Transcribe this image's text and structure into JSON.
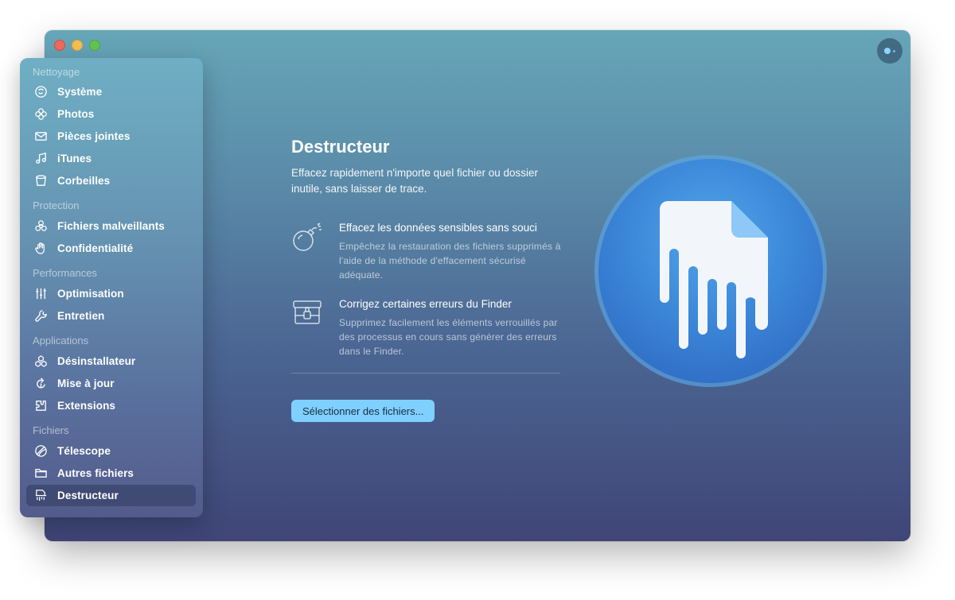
{
  "sidebar": {
    "sections": [
      {
        "title": "Nettoyage",
        "items": [
          {
            "label": "Système",
            "icon": "system-icon"
          },
          {
            "label": "Photos",
            "icon": "photos-icon"
          },
          {
            "label": "Pièces jointes",
            "icon": "mail-icon"
          },
          {
            "label": "iTunes",
            "icon": "music-icon"
          },
          {
            "label": "Corbeilles",
            "icon": "trash-icon"
          }
        ]
      },
      {
        "title": "Protection",
        "items": [
          {
            "label": "Fichiers malveillants",
            "icon": "biohazard-icon"
          },
          {
            "label": "Confidentialité",
            "icon": "hand-icon"
          }
        ]
      },
      {
        "title": "Performances",
        "items": [
          {
            "label": "Optimisation",
            "icon": "sliders-icon"
          },
          {
            "label": "Entretien",
            "icon": "wrench-icon"
          }
        ]
      },
      {
        "title": "Applications",
        "items": [
          {
            "label": "Désinstallateur",
            "icon": "uninstaller-icon"
          },
          {
            "label": "Mise à jour",
            "icon": "update-icon"
          },
          {
            "label": "Extensions",
            "icon": "extensions-icon"
          }
        ]
      },
      {
        "title": "Fichiers",
        "items": [
          {
            "label": "Télescope",
            "icon": "lens-icon"
          },
          {
            "label": "Autres fichiers",
            "icon": "folder-icon"
          },
          {
            "label": "Destructeur",
            "icon": "shredder-icon",
            "active": true
          }
        ]
      }
    ]
  },
  "main": {
    "title": "Destructeur",
    "description": "Effacez rapidement n'importe quel fichier ou dossier inutile, sans laisser de trace.",
    "features": [
      {
        "icon": "bomb-icon",
        "title": "Effacez les données sensibles sans souci",
        "description": "Empêchez la restauration des fichiers supprimés à l'aide de la méthode d'effacement sécurisé adéquate."
      },
      {
        "icon": "locked-box-icon",
        "title": "Corrigez certaines erreurs du Finder",
        "description": "Supprimez facilement les éléments verrouillés par des processus en cours sans générer des erreurs dans le Finder."
      }
    ],
    "select_button": "Sélectionner des fichiers..."
  },
  "colors": {
    "accent": "#7fd0ff",
    "hero_blue": "#3a86d8"
  }
}
